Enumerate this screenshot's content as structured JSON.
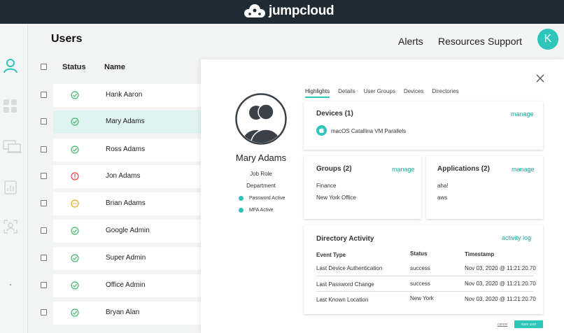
{
  "header": {
    "logo_text": "jumpcloud"
  },
  "rail": {
    "icons": [
      "user-icon",
      "grid-icon",
      "devices-icon",
      "reports-icon",
      "id-scan-icon",
      "dot-icon"
    ],
    "accent": "#2ec5ba"
  },
  "page": {
    "title": "Users",
    "nav": [
      "Alerts",
      "Resources",
      "Support"
    ],
    "avatar_letter": "K"
  },
  "table": {
    "headers": {
      "status": "Status",
      "name": "Name"
    },
    "rows": [
      {
        "name": "Hank Aaron",
        "status": "active"
      },
      {
        "name": "Mary Adams",
        "status": "active",
        "selected": true
      },
      {
        "name": "Ross Adams",
        "status": "active"
      },
      {
        "name": "Jon Adams",
        "status": "error"
      },
      {
        "name": "Brian Adams",
        "status": "pending"
      },
      {
        "name": "Google Admin",
        "status": "active"
      },
      {
        "name": "Super Admin",
        "status": "active"
      },
      {
        "name": "Office Admin",
        "status": "active"
      },
      {
        "name": "Bryan Alan",
        "status": "active"
      }
    ]
  },
  "panel": {
    "profile": {
      "name": "Mary Adams",
      "job_role": "Job Role",
      "department": "Department",
      "flags": [
        "Password Active",
        "MFA Active"
      ]
    },
    "tabs": [
      "Highlights",
      "Details",
      "User Groups",
      "Devices",
      "Directories"
    ],
    "devices": {
      "title": "Devices (1)",
      "link": "manage",
      "items": [
        "macOS Catallina VM Parallels"
      ]
    },
    "groups": {
      "title": "Groups (2)",
      "link": "manage",
      "items": [
        "Finance",
        "New York Office"
      ]
    },
    "applications": {
      "title": "Applications (2)",
      "link": "manage",
      "items": [
        "aha!",
        "aws"
      ]
    },
    "activity": {
      "title": "Directory Activity",
      "link": "activity log",
      "headers": [
        "Event Type",
        "Status",
        "Timestamp"
      ],
      "rows": [
        [
          "Last Device Authentication",
          "success",
          "Nov 03, 2020 @ 11:21:20.70"
        ],
        [
          "Last Password Change",
          "success",
          "Nov 03, 2020 @ 11:21:20.70"
        ],
        [
          "Last Known Location",
          "New York",
          "Nov 03, 2020 @ 11:21:20.70"
        ]
      ]
    },
    "footer": {
      "cancel": "cancel",
      "save": "save user"
    }
  }
}
